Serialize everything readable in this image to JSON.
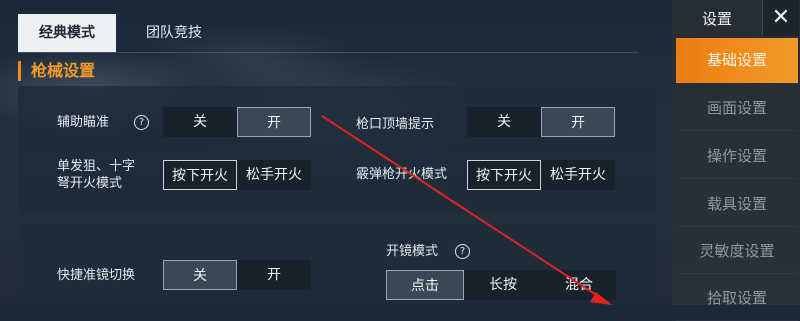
{
  "tabs": [
    {
      "label": "经典模式",
      "active": true
    },
    {
      "label": "团队竞技",
      "active": false
    }
  ],
  "section_title": "枪械设置",
  "help_symbol": "?",
  "settings": {
    "aim_assist": {
      "label": "辅助瞄准",
      "options": [
        "关",
        "开"
      ],
      "selected": "开"
    },
    "wall_hint": {
      "label": "枪口顶墙提示",
      "options": [
        "关",
        "开"
      ],
      "selected": "开"
    },
    "single_fire": {
      "label_line1": "单发狙、十字",
      "label_line2": "弩开火模式",
      "options": [
        "按下开火",
        "松手开火"
      ],
      "selected": "按下开火"
    },
    "shotgun_fire": {
      "label": "霰弹枪开火模式",
      "options": [
        "按下开火",
        "松手开火"
      ],
      "selected": "按下开火"
    },
    "quick_scope": {
      "label": "快捷准镜切换",
      "options": [
        "关",
        "开"
      ],
      "selected": "关"
    },
    "scope_mode": {
      "label": "开镜模式",
      "options": [
        "点击",
        "长按",
        "混合"
      ],
      "selected": "点击"
    }
  },
  "sidebar": {
    "title": "设置",
    "close_glyph": "✕",
    "items": [
      {
        "label": "基础设置",
        "active": true
      },
      {
        "label": "画面设置",
        "active": false
      },
      {
        "label": "操作设置",
        "active": false
      },
      {
        "label": "载具设置",
        "active": false
      },
      {
        "label": "灵敏度设置",
        "active": false
      },
      {
        "label": "拾取设置",
        "active": false
      }
    ]
  },
  "colors": {
    "accent": "#f39a2a",
    "annotation": "#e0231e"
  }
}
